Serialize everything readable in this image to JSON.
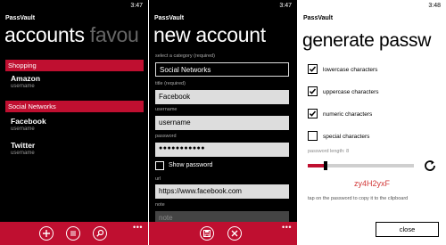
{
  "screen1": {
    "time": "3:47",
    "app_name": "PassVault",
    "title": "accounts",
    "title_next": "favou",
    "groups": [
      {
        "label": "Shopping",
        "accounts": [
          {
            "name": "Amazon",
            "username": "username"
          }
        ]
      },
      {
        "label": "Social Networks",
        "accounts": [
          {
            "name": "Facebook",
            "username": "username"
          },
          {
            "name": "Twitter",
            "username": "username"
          }
        ]
      }
    ],
    "appbar": {
      "icons": [
        "add-icon",
        "list-icon",
        "search-icon"
      ],
      "more": "•••"
    }
  },
  "screen2": {
    "time": "3:47",
    "app_name": "PassVault",
    "title": "new account",
    "category_label": "select a category (required)",
    "category_value": "Social Networks",
    "title_label": "title (required)",
    "title_value": "Facebook",
    "username_label": "username",
    "username_value": "username",
    "password_label": "password",
    "password_value": "●●●●●●●●●●●",
    "show_password_label": "Show password",
    "url_label": "url",
    "url_value": "https://www.facebook.com",
    "note_label": "note",
    "note_placeholder": "note",
    "appbar": {
      "icons": [
        "save-icon",
        "cancel-icon"
      ],
      "more": "•••"
    }
  },
  "screen3": {
    "time": "3:48",
    "app_name": "PassVault",
    "title": "generate passw",
    "options": [
      {
        "label": "lowercase characters",
        "checked": true
      },
      {
        "label": "uppercase characters",
        "checked": true
      },
      {
        "label": "numeric characters",
        "checked": true
      },
      {
        "label": "special characters",
        "checked": false
      }
    ],
    "length_label": "password length: 8",
    "length_value": 8,
    "slider_fraction": 0.15,
    "generated_password": "zy4H2yxF",
    "hint": "tap on the password to copy it to the clipboard",
    "close_label": "close"
  },
  "colors": {
    "accent": "#bf0f30",
    "password_text": "#d23a3a"
  }
}
